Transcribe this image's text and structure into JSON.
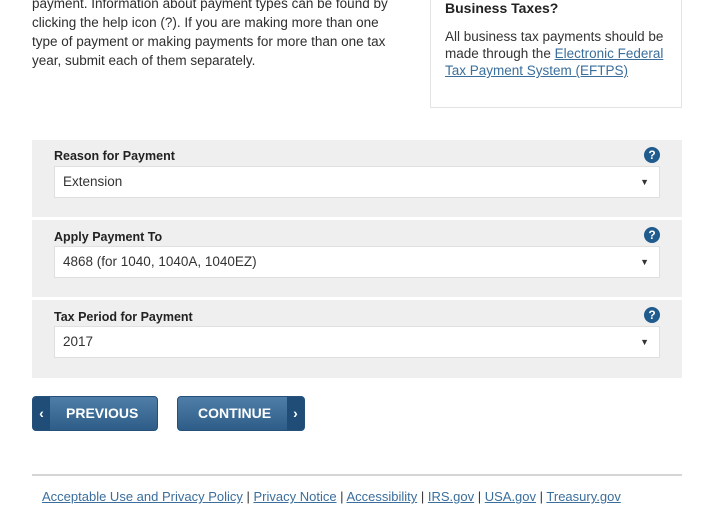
{
  "intro": {
    "line1": "payment. Information about payment types can be found by",
    "line2": "clicking the help icon (?). If you are making more than one",
    "line3": "type of payment or making payments for more than one tax",
    "line4": "year, submit each of them separately."
  },
  "sidebox": {
    "title": "Business Taxes?",
    "text": "All business tax payments should be made through the ",
    "link": "Electronic Federal Tax Payment System (EFTPS)"
  },
  "form": {
    "fields": [
      {
        "label": "Reason for Payment",
        "value": "Extension"
      },
      {
        "label": "Apply Payment To",
        "value": "4868 (for 1040, 1040A, 1040EZ)"
      },
      {
        "label": "Tax Period for Payment",
        "value": "2017"
      }
    ],
    "help_glyph": "?",
    "caret_glyph": "▼"
  },
  "buttons": {
    "previous": "PREVIOUS",
    "continue": "CONTINUE",
    "prev_chevron": "‹",
    "next_chevron": "›"
  },
  "footer": {
    "links": [
      "Acceptable Use and Privacy Policy",
      "Privacy Notice",
      "Accessibility",
      "IRS.gov",
      "USA.gov",
      "Treasury.gov"
    ],
    "separator": " | "
  },
  "colors": {
    "accent": "#2d5d88",
    "link": "#3b6e9c",
    "panel": "#efefef"
  }
}
